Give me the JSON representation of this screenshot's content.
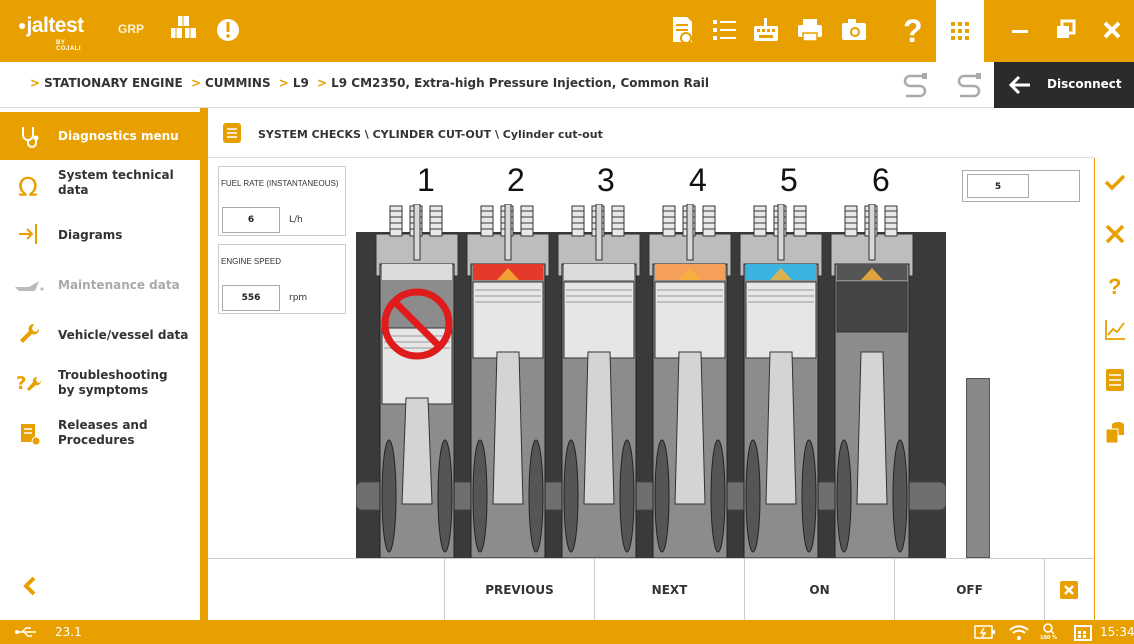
{
  "app": {
    "brand": "jaltest",
    "brand_sub": "BY COJALI",
    "grp": "GRP"
  },
  "breadcrumb": [
    "STATIONARY ENGINE",
    "CUMMINS",
    "L9",
    "L9 CM2350, Extra-high Pressure Injection, Common Rail"
  ],
  "disconnect_label": "Disconnect",
  "sidebar": {
    "items": [
      {
        "label": "Diagnostics menu"
      },
      {
        "label": "System technical data"
      },
      {
        "label": "Diagrams"
      },
      {
        "label": "Maintenance data"
      },
      {
        "label": "Vehicle/vessel data"
      },
      {
        "label": "Troubleshooting by symptoms"
      },
      {
        "label": "Releases and Procedures"
      }
    ]
  },
  "main": {
    "title": "SYSTEM CHECKS \\ CYLINDER CUT-OUT \\ Cylinder cut-out"
  },
  "readouts": {
    "fuel": {
      "label": "FUEL RATE (INSTANTANEOUS)",
      "value": "6",
      "unit": "L/h"
    },
    "speed": {
      "label": "ENGINE SPEED",
      "value": "556",
      "unit": "rpm"
    }
  },
  "cylinders": {
    "numbers": [
      "1",
      "2",
      "3",
      "4",
      "5",
      "6"
    ],
    "selected": "5",
    "flames": [
      "cut-out",
      "#e53a2a",
      "none",
      "#f4a05a",
      "#3bb3e0",
      "#555555"
    ]
  },
  "buttons": {
    "previous": "PREVIOUS",
    "next": "NEXT",
    "on": "ON",
    "off": "OFF"
  },
  "status": {
    "version": "23.1",
    "zoom": "100 %",
    "time": "15:34"
  },
  "colors": {
    "accent": "#e8a000",
    "dark": "#2b2b2b"
  },
  "icons": {
    "top": [
      "document-view-icon",
      "list-icon",
      "keyboard-icon",
      "printer-icon",
      "camera-icon",
      "help-icon",
      "apps-grid-icon",
      "minimize-icon",
      "restore-icon",
      "close-icon"
    ],
    "right": [
      "accept-icon",
      "cancel-icon",
      "help-icon",
      "graph-icon",
      "report-icon",
      "database-icon"
    ]
  }
}
